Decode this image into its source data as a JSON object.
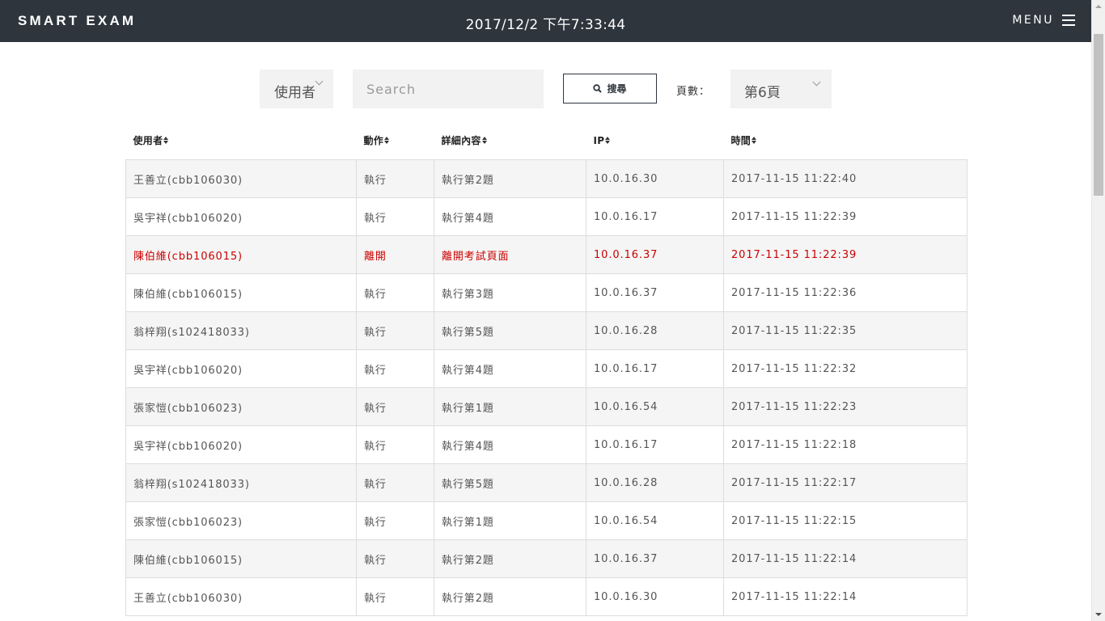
{
  "header": {
    "brand": "SMART EXAM",
    "datetime": "2017/12/2 下午7:33:44",
    "menu_label": "MENU"
  },
  "filters": {
    "user_select": "使用者",
    "search_placeholder": "Search",
    "search_button": "搜尋",
    "page_label": "頁數：",
    "page_select": "第6頁"
  },
  "table": {
    "columns": [
      "使用者",
      "動作",
      "詳細內容",
      "IP",
      "時間"
    ],
    "highlight_color": "#cc0000",
    "rows": [
      {
        "user": "王善立(cbb106030)",
        "action": "執行",
        "detail": "執行第2題",
        "ip": "10.0.16.30",
        "time": "2017-11-15 11:22:40",
        "alert": false
      },
      {
        "user": "吳宇祥(cbb106020)",
        "action": "執行",
        "detail": "執行第4題",
        "ip": "10.0.16.17",
        "time": "2017-11-15 11:22:39",
        "alert": false
      },
      {
        "user": "陳伯維(cbb106015)",
        "action": "離開",
        "detail": "離開考試頁面",
        "ip": "10.0.16.37",
        "time": "2017-11-15 11:22:39",
        "alert": true
      },
      {
        "user": "陳伯維(cbb106015)",
        "action": "執行",
        "detail": "執行第3題",
        "ip": "10.0.16.37",
        "time": "2017-11-15 11:22:36",
        "alert": false
      },
      {
        "user": "翁梓翔(s102418033)",
        "action": "執行",
        "detail": "執行第5題",
        "ip": "10.0.16.28",
        "time": "2017-11-15 11:22:35",
        "alert": false
      },
      {
        "user": "吳宇祥(cbb106020)",
        "action": "執行",
        "detail": "執行第4題",
        "ip": "10.0.16.17",
        "time": "2017-11-15 11:22:32",
        "alert": false
      },
      {
        "user": "張家愷(cbb106023)",
        "action": "執行",
        "detail": "執行第1題",
        "ip": "10.0.16.54",
        "time": "2017-11-15 11:22:23",
        "alert": false
      },
      {
        "user": "吳宇祥(cbb106020)",
        "action": "執行",
        "detail": "執行第4題",
        "ip": "10.0.16.17",
        "time": "2017-11-15 11:22:18",
        "alert": false
      },
      {
        "user": "翁梓翔(s102418033)",
        "action": "執行",
        "detail": "執行第5題",
        "ip": "10.0.16.28",
        "time": "2017-11-15 11:22:17",
        "alert": false
      },
      {
        "user": "張家愷(cbb106023)",
        "action": "執行",
        "detail": "執行第1題",
        "ip": "10.0.16.54",
        "time": "2017-11-15 11:22:15",
        "alert": false
      },
      {
        "user": "陳伯維(cbb106015)",
        "action": "執行",
        "detail": "執行第2題",
        "ip": "10.0.16.37",
        "time": "2017-11-15 11:22:14",
        "alert": false
      },
      {
        "user": "王善立(cbb106030)",
        "action": "執行",
        "detail": "執行第2題",
        "ip": "10.0.16.30",
        "time": "2017-11-15 11:22:14",
        "alert": false
      }
    ]
  }
}
